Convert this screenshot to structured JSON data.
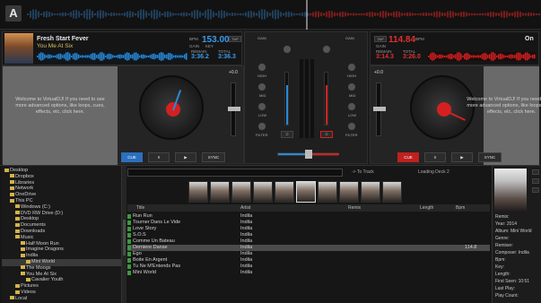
{
  "app": {
    "logo": "A"
  },
  "deck_left": {
    "title": "Fresh Start Fever",
    "artist": "You Me At Six",
    "bpm": "153.00",
    "key_label": "KEY",
    "gain_label": "GAIN",
    "remain_label": "REMAIN",
    "total_label": "TOTAL",
    "bpm_label": "BPM",
    "tap_label": "TAP",
    "remain": "3:36.2",
    "total": "3:36.3",
    "pitch": "+0.0",
    "welcome_text": "Welcome to VirtualDJ! If you need to see more advanced options, like loops, cues, effects, etc, click here.",
    "buttons": {
      "cue": "CUE",
      "pause": "II",
      "play": "▶",
      "sync": "SYNC"
    },
    "accent": "#2a8ad8"
  },
  "deck_right": {
    "title": "On",
    "bpm": "114.84",
    "remain": "3:14.3",
    "total": "3:26.0",
    "pitch": "+0.0",
    "welcome_text": "Welcome to VirtualDJ! If you need to see more advanced options, like loops, cues, effects, etc, click here.",
    "buttons": {
      "cue": "CUE",
      "pause": "II",
      "play": "▶",
      "sync": "SYNC"
    },
    "accent": "#d52020"
  },
  "mixer": {
    "labels": {
      "high": "HIGH",
      "mid": "MID",
      "low": "LOW",
      "filter": "FILTER",
      "gain": "GAIN"
    }
  },
  "browser": {
    "hint": "-> To Track",
    "load_hint": "Loading Deck 2",
    "folders": [
      {
        "label": "Desktop",
        "indent": 0
      },
      {
        "label": "Dropbox",
        "indent": 1
      },
      {
        "label": "Libraries",
        "indent": 1
      },
      {
        "label": "Network",
        "indent": 1
      },
      {
        "label": "OneDrive",
        "indent": 1
      },
      {
        "label": "This PC",
        "indent": 1
      },
      {
        "label": "Windows (C:)",
        "indent": 2
      },
      {
        "label": "DVD RW Drive (D:)",
        "indent": 2
      },
      {
        "label": "Desktop",
        "indent": 2
      },
      {
        "label": "Documents",
        "indent": 2
      },
      {
        "label": "Downloads",
        "indent": 2
      },
      {
        "label": "Music",
        "indent": 2
      },
      {
        "label": "Half Moon Run",
        "indent": 3
      },
      {
        "label": "Imagine Dragons",
        "indent": 3
      },
      {
        "label": "Indila",
        "indent": 3
      },
      {
        "label": "Mini World",
        "indent": 4,
        "selected": true
      },
      {
        "label": "The Moogs",
        "indent": 3
      },
      {
        "label": "You Me At Six",
        "indent": 3
      },
      {
        "label": "Cavalier Youth",
        "indent": 4
      },
      {
        "label": "Pictures",
        "indent": 2
      },
      {
        "label": "Videos",
        "indent": 2
      },
      {
        "label": "Local",
        "indent": 1
      }
    ],
    "columns": {
      "title": "Title",
      "artist": "Artist",
      "remix": "Remix",
      "length": "Length",
      "bpm": "Bpm"
    },
    "tracks": [
      {
        "title": "Run Run",
        "artist": "Indila",
        "bpm": ""
      },
      {
        "title": "Tourner Dans Le Vide",
        "artist": "Indila",
        "bpm": ""
      },
      {
        "title": "Love Story",
        "artist": "Indila",
        "bpm": ""
      },
      {
        "title": "S.O.S",
        "artist": "Indila",
        "bpm": ""
      },
      {
        "title": "Comme Un Bateau",
        "artist": "Indila",
        "bpm": ""
      },
      {
        "title": "Derniere Danse",
        "artist": "Indila",
        "bpm": "114.8",
        "selected": true
      },
      {
        "title": "Ego",
        "artist": "Indila",
        "bpm": ""
      },
      {
        "title": "Boite En Argent",
        "artist": "Indila",
        "bpm": ""
      },
      {
        "title": "Tu Ne M'Entends Pas",
        "artist": "Indila",
        "bpm": ""
      },
      {
        "title": "Mini World",
        "artist": "Indila",
        "bpm": ""
      }
    ]
  },
  "info": {
    "lines": [
      "Remix:",
      "Year: 2014",
      "Album: Mini World",
      "Genre:",
      "Remixer:",
      "Composer: Indila",
      "Bpm:",
      "Key:",
      "Length:",
      "First Seen: 10:51",
      "Last Play:",
      "Play Count:"
    ]
  }
}
